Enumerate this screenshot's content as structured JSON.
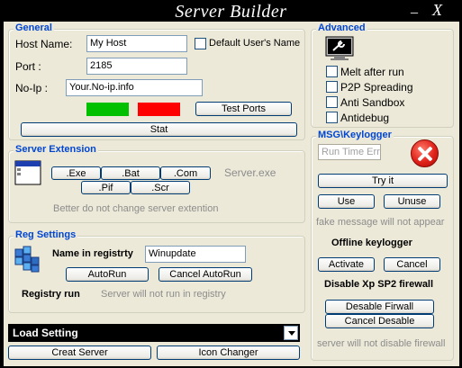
{
  "window": {
    "title": "Server Builder",
    "minimize_glyph": "_",
    "close_glyph": "X"
  },
  "general": {
    "title": "General",
    "host_label": "Host Name:",
    "host_value": "My Host",
    "default_user_label": "Default User's Name",
    "default_user_checked": false,
    "port_label": "Port :",
    "port_value": "2185",
    "noip_label": "No-Ip :",
    "noip_value": "Your.No-ip.info",
    "status_colors": [
      "#00c000",
      "#ff0000"
    ],
    "test_ports_label": "Test Ports",
    "stat_label": "Stat"
  },
  "server_extension": {
    "title": "Server Extension",
    "icon": "window-icon",
    "ext_buttons": [
      ".Exe",
      ".Bat",
      ".Com",
      ".Pif",
      ".Scr"
    ],
    "current_file": "Server.exe",
    "hint": "Better do not change server extention"
  },
  "reg_settings": {
    "title": "Reg Settings",
    "icon": "registry-icon",
    "name_label": "Name in registrty",
    "name_value": "Winupdate",
    "autorun_label": "AutoRun",
    "cancel_autorun_label": "Cancel AutoRun",
    "run_label": "Registry run",
    "run_status": "Server will not run in registry"
  },
  "bottom": {
    "load_setting": "Load Setting",
    "create_server_label": "Creat Server",
    "icon_changer_label": "Icon Changer"
  },
  "advanced": {
    "title": "Advanced",
    "icon": "wrench-monitor-icon",
    "options": [
      {
        "label": "Melt after run",
        "checked": false
      },
      {
        "label": "P2P Spreading",
        "checked": false
      },
      {
        "label": "Anti Sandbox",
        "checked": false
      },
      {
        "label": "Antidebug",
        "checked": false
      }
    ]
  },
  "msg_keylogger": {
    "title": "MSG\\Keylogger",
    "msg_placeholder": "Run Time Error",
    "icon": "error-icon",
    "try_label": "Try it",
    "use_label": "Use",
    "unuse_label": "Unuse",
    "fake_status": "fake message will not  appear",
    "offline_title": "Offline keylogger",
    "activate_label": "Activate",
    "cancel_label": "Cancel",
    "firewall_title": "Disable Xp SP2 firewall",
    "disable_fw_label": "Desable Firwall",
    "cancel_disable_label": "Cancel Desable",
    "fw_status": "server will not disable firewall"
  }
}
